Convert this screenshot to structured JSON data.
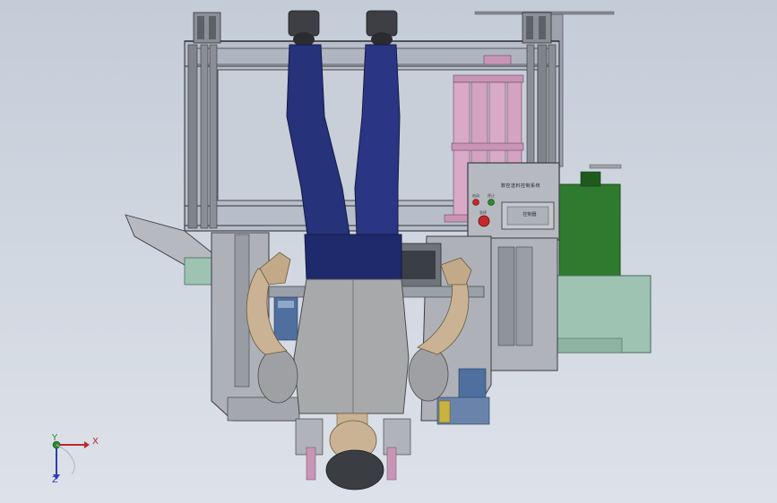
{
  "viewport": {
    "background_top": "#c4ccd8",
    "background_bottom": "#dde2ea"
  },
  "control_panel": {
    "title": "数控送料控制系统",
    "display_text": "控制器",
    "button_labels": [
      "启动",
      "停止",
      "急停"
    ]
  },
  "triad": {
    "x_label": "X",
    "y_label": "Y",
    "z_label": "Z",
    "x_color": "#c0262b",
    "y_color": "#2b8a2b",
    "z_color": "#2b3fb8"
  },
  "colors": {
    "frame": "#9ea2aa",
    "frame_dark": "#4a4e55",
    "cylinder": "#d8a8c8",
    "green_box": "#2e7a2e",
    "mint_base": "#9ec3b3",
    "pants": "#26327a",
    "shirt": "#a8a9ab",
    "skin": "#c9b394",
    "hair": "#3a3d42"
  }
}
